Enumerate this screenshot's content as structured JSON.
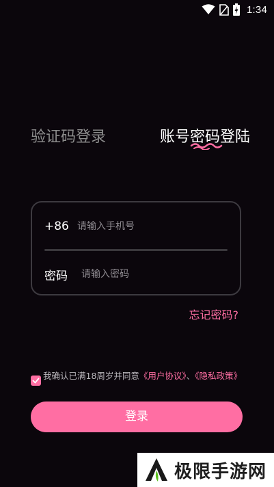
{
  "status_bar": {
    "time": "1:34",
    "icons": [
      "wifi-icon",
      "no-sim-icon",
      "battery-charging-icon"
    ]
  },
  "tabs": {
    "sms_login": "验证码登录",
    "password_login": "账号密码登陆"
  },
  "form": {
    "phone_prefix": "+86",
    "phone_placeholder": "请输入手机号",
    "phone_value": "",
    "password_label": "密码",
    "password_placeholder": "请输入密码",
    "password_value": ""
  },
  "forgot_password": "忘记密码?",
  "agreement": {
    "checked": true,
    "text_prefix": "我确认已满18周岁并同意",
    "user_agreement": "《用户协议》",
    "separator": "、",
    "privacy_policy": "《隐私政策》"
  },
  "login_button": "登录",
  "watermark": {
    "text": "极限手游网"
  },
  "colors": {
    "background": "#0b060c",
    "accent": "#ff6ea3",
    "inactive_tab": "#8c8c8c",
    "card_border": "#3d3a40"
  }
}
